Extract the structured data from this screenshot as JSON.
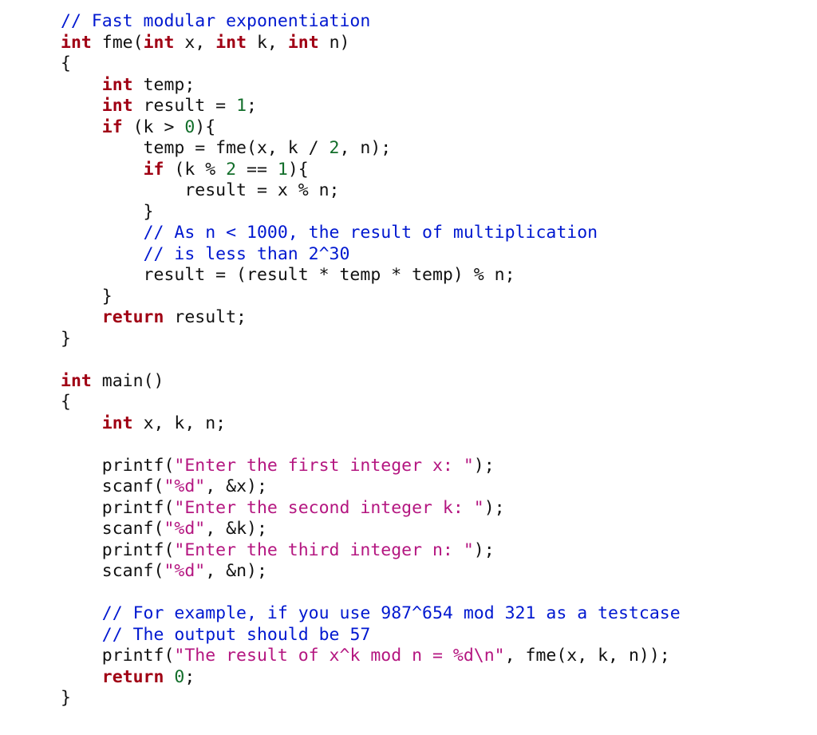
{
  "code": {
    "tokens": [
      {
        "cls": "c-comment",
        "t": "// Fast modular exponentiation"
      },
      {
        "t": "\n"
      },
      {
        "cls": "c-keyword",
        "t": "int"
      },
      {
        "t": " fme("
      },
      {
        "cls": "c-keyword",
        "t": "int"
      },
      {
        "t": " x, "
      },
      {
        "cls": "c-keyword",
        "t": "int"
      },
      {
        "t": " k, "
      },
      {
        "cls": "c-keyword",
        "t": "int"
      },
      {
        "t": " n)"
      },
      {
        "t": "\n"
      },
      {
        "t": "{"
      },
      {
        "t": "\n"
      },
      {
        "t": "    "
      },
      {
        "cls": "c-keyword",
        "t": "int"
      },
      {
        "t": " temp;"
      },
      {
        "t": "\n"
      },
      {
        "t": "    "
      },
      {
        "cls": "c-keyword",
        "t": "int"
      },
      {
        "t": " result = "
      },
      {
        "cls": "c-number",
        "t": "1"
      },
      {
        "t": ";"
      },
      {
        "t": "\n"
      },
      {
        "t": "    "
      },
      {
        "cls": "c-keyword",
        "t": "if"
      },
      {
        "t": " (k > "
      },
      {
        "cls": "c-number",
        "t": "0"
      },
      {
        "t": "){"
      },
      {
        "t": "\n"
      },
      {
        "t": "        temp = fme(x, k / "
      },
      {
        "cls": "c-number",
        "t": "2"
      },
      {
        "t": ", n);"
      },
      {
        "t": "\n"
      },
      {
        "t": "        "
      },
      {
        "cls": "c-keyword",
        "t": "if"
      },
      {
        "t": " (k % "
      },
      {
        "cls": "c-number",
        "t": "2"
      },
      {
        "t": " == "
      },
      {
        "cls": "c-number",
        "t": "1"
      },
      {
        "t": "){"
      },
      {
        "t": "\n"
      },
      {
        "t": "            result = x % n;"
      },
      {
        "t": "\n"
      },
      {
        "t": "        }"
      },
      {
        "t": "\n"
      },
      {
        "t": "        "
      },
      {
        "cls": "c-comment",
        "t": "// As n < 1000, the result of multiplication"
      },
      {
        "t": "\n"
      },
      {
        "t": "        "
      },
      {
        "cls": "c-comment",
        "t": "// is less than 2^30"
      },
      {
        "t": "\n"
      },
      {
        "t": "        result = (result * temp * temp) % n;"
      },
      {
        "t": "\n"
      },
      {
        "t": "    }"
      },
      {
        "t": "\n"
      },
      {
        "t": "    "
      },
      {
        "cls": "c-keyword",
        "t": "return"
      },
      {
        "t": " result;"
      },
      {
        "t": "\n"
      },
      {
        "t": "}"
      },
      {
        "t": "\n"
      },
      {
        "t": "\n"
      },
      {
        "cls": "c-keyword",
        "t": "int"
      },
      {
        "t": " main()"
      },
      {
        "t": "\n"
      },
      {
        "t": "{"
      },
      {
        "t": "\n"
      },
      {
        "t": "    "
      },
      {
        "cls": "c-keyword",
        "t": "int"
      },
      {
        "t": " x, k, n;"
      },
      {
        "t": "\n"
      },
      {
        "t": "\n"
      },
      {
        "t": "    printf("
      },
      {
        "cls": "c-string",
        "t": "\"Enter the first integer x: \""
      },
      {
        "t": ");"
      },
      {
        "t": "\n"
      },
      {
        "t": "    scanf("
      },
      {
        "cls": "c-string",
        "t": "\"%d\""
      },
      {
        "t": ", &x);"
      },
      {
        "t": "\n"
      },
      {
        "t": "    printf("
      },
      {
        "cls": "c-string",
        "t": "\"Enter the second integer k: \""
      },
      {
        "t": ");"
      },
      {
        "t": "\n"
      },
      {
        "t": "    scanf("
      },
      {
        "cls": "c-string",
        "t": "\"%d\""
      },
      {
        "t": ", &k);"
      },
      {
        "t": "\n"
      },
      {
        "t": "    printf("
      },
      {
        "cls": "c-string",
        "t": "\"Enter the third integer n: \""
      },
      {
        "t": ");"
      },
      {
        "t": "\n"
      },
      {
        "t": "    scanf("
      },
      {
        "cls": "c-string",
        "t": "\"%d\""
      },
      {
        "t": ", &n);"
      },
      {
        "t": "\n"
      },
      {
        "t": "\n"
      },
      {
        "t": "    "
      },
      {
        "cls": "c-comment",
        "t": "// For example, if you use 987^654 mod 321 as a testcase"
      },
      {
        "t": "\n"
      },
      {
        "t": "    "
      },
      {
        "cls": "c-comment",
        "t": "// The output should be 57"
      },
      {
        "t": "\n"
      },
      {
        "t": "    printf("
      },
      {
        "cls": "c-string",
        "t": "\"The result of x^k mod n = %d\\n\""
      },
      {
        "t": ", fme(x, k, n));"
      },
      {
        "t": "\n"
      },
      {
        "t": "    "
      },
      {
        "cls": "c-keyword",
        "t": "return"
      },
      {
        "t": " "
      },
      {
        "cls": "c-number",
        "t": "0"
      },
      {
        "t": ";"
      },
      {
        "t": "\n"
      },
      {
        "t": "}"
      }
    ]
  }
}
